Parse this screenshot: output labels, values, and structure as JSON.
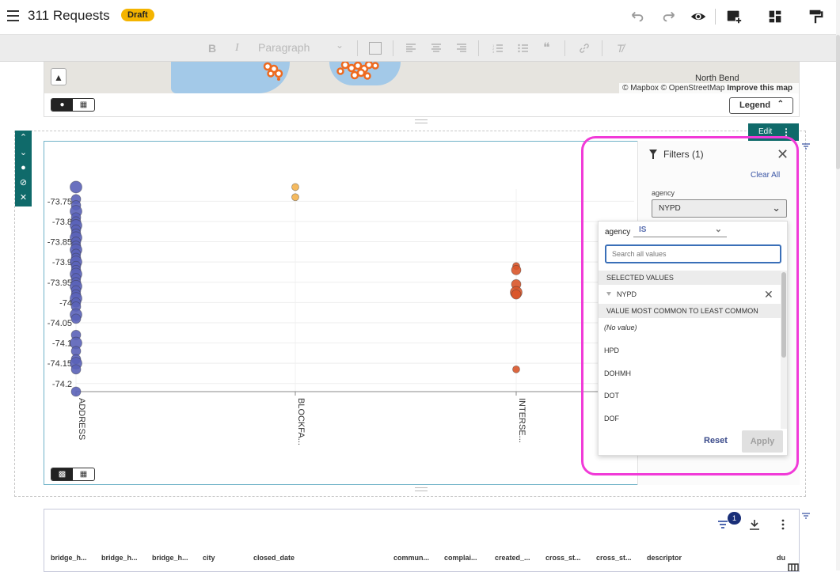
{
  "topbar": {
    "title": "311 Requests",
    "badge": "Draft",
    "icons": [
      "undo-icon",
      "redo-icon",
      "preview-eye-icon",
      "add-widget-icon",
      "layout-icon",
      "format-icon"
    ]
  },
  "editor_toolbar": {
    "bold": "B",
    "italic": "I",
    "paragraph": "Paragraph",
    "quote": "❝",
    "clear_format": "T̸"
  },
  "map": {
    "attribution": "© Mapbox © OpenStreetMap",
    "improve_link": "Improve this map",
    "place_label": "North Bend",
    "legend_label": "Legend",
    "zoom_label": "▲"
  },
  "widget_tools": {
    "edit_label": "Edit"
  },
  "chart_data": {
    "type": "scatter",
    "title": "",
    "xlabel": "",
    "ylabel": "",
    "categories": [
      "ADDRESS",
      "BLOCKFA...",
      "INTERSE..."
    ],
    "y_ticks": [
      "-73.75",
      "-73.8",
      "-73.85",
      "-73.9",
      "-73.95",
      "-74",
      "-74.05",
      "-74.1",
      "-74.15",
      "-74.2"
    ],
    "ylim": [
      -74.22,
      -73.72
    ],
    "series": [
      {
        "color": "#5a62b8",
        "category": "ADDRESS",
        "points": [
          -73.715,
          -73.745,
          -73.76,
          -73.775,
          -73.79,
          -73.8,
          -73.81,
          -73.82,
          -73.83,
          -73.84,
          -73.85,
          -73.86,
          -73.87,
          -73.88,
          -73.89,
          -73.9,
          -73.91,
          -73.92,
          -73.93,
          -73.94,
          -73.95,
          -73.96,
          -73.97,
          -73.98,
          -73.99,
          -74.0,
          -74.01,
          -74.03,
          -74.04,
          -74.08,
          -74.1,
          -74.12,
          -74.14,
          -74.15,
          -74.165,
          -74.22
        ]
      },
      {
        "color": "#f4b34e",
        "category": "BLOCKFA...",
        "points": [
          -73.715,
          -73.74
        ]
      },
      {
        "color": "#d9552a",
        "category": "INTERSE...",
        "points": [
          -73.91,
          -73.92,
          -73.955,
          -73.975,
          -73.98,
          -74.165
        ]
      }
    ]
  },
  "filters": {
    "title": "Filters (1)",
    "clear_all": "Clear All",
    "field_label": "agency",
    "field_value": "NYPD",
    "dropdown": {
      "field": "agency",
      "operator": "IS",
      "search_placeholder": "Search all values",
      "selected_header": "SELECTED VALUES",
      "selected": [
        "NYPD"
      ],
      "common_header": "VALUE MOST COMMON TO LEAST COMMON",
      "values": [
        "(No value)",
        "HPD",
        "DOHMH",
        "DOT",
        "DOF"
      ],
      "reset": "Reset",
      "apply": "Apply"
    }
  },
  "table": {
    "filter_count": "1",
    "columns": [
      "bridge_h...",
      "bridge_h...",
      "bridge_h...",
      "city",
      "closed_date",
      "commun...",
      "complai...",
      "created_...",
      "cross_st...",
      "cross_st...",
      "descriptor",
      "du"
    ]
  },
  "colors": {
    "accent_teal": "#0f6a6a",
    "highlight_magenta": "#f13ad8",
    "draft_yellow": "#f4b400",
    "link_blue": "#3a55a5"
  }
}
